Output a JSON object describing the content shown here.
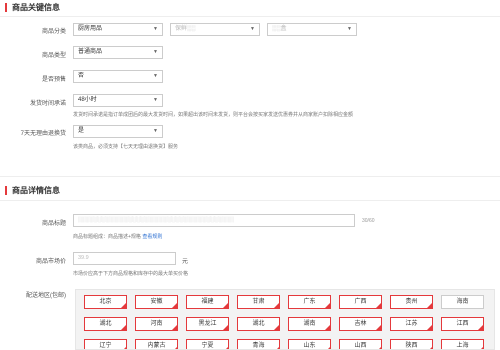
{
  "key_info": {
    "title": "商品关键信息",
    "category_label": "商品分类",
    "category_values": [
      "厨房用品",
      "保鲜░░",
      "░░盒"
    ],
    "type_label": "商品类型",
    "type_value": "普通商品",
    "presale_label": "是否预售",
    "presale_value": "否",
    "ship_time_label": "发货时间承诺",
    "ship_time_value": "48小时",
    "ship_time_hint": "发货时间承诺是指订单成团后的最大发货时间，如果超出该时间未发货，则平台会按买家发送优惠券并从商家账户扣除相应金额",
    "return_label": "7天无理由退换货",
    "return_value": "是",
    "return_hint": "该类商品，必须支持【七天无理由退换货】服务"
  },
  "detail_info": {
    "title": "商品详情信息",
    "name_label": "商品标题",
    "name_placeholder": "░░░░░░░░░░░░░░░░░░░░░░░░░░░░░░░░░░░░░░░░",
    "name_counter": "30/60",
    "name_hint": "商品标题组成：商品描述+规格",
    "name_hint_link": "查看规则",
    "price_label": "商品市场价",
    "price_value": "39.9",
    "price_unit": "元",
    "price_hint": "市场价应高于下方商品规格和库存中的最大单买价格",
    "region_label": "配送地区(包邮)"
  },
  "regions": [
    "北京",
    "安徽",
    "福建",
    "甘肃",
    "广东",
    "广西",
    "贵州",
    "海南",
    "湖北",
    "河南",
    "黑龙江",
    "湖北",
    "湖南",
    "吉林",
    "江苏",
    "江西",
    "辽宁",
    "内蒙古",
    "宁夏",
    "青海",
    "山东",
    "山西",
    "陕西",
    "上海"
  ]
}
